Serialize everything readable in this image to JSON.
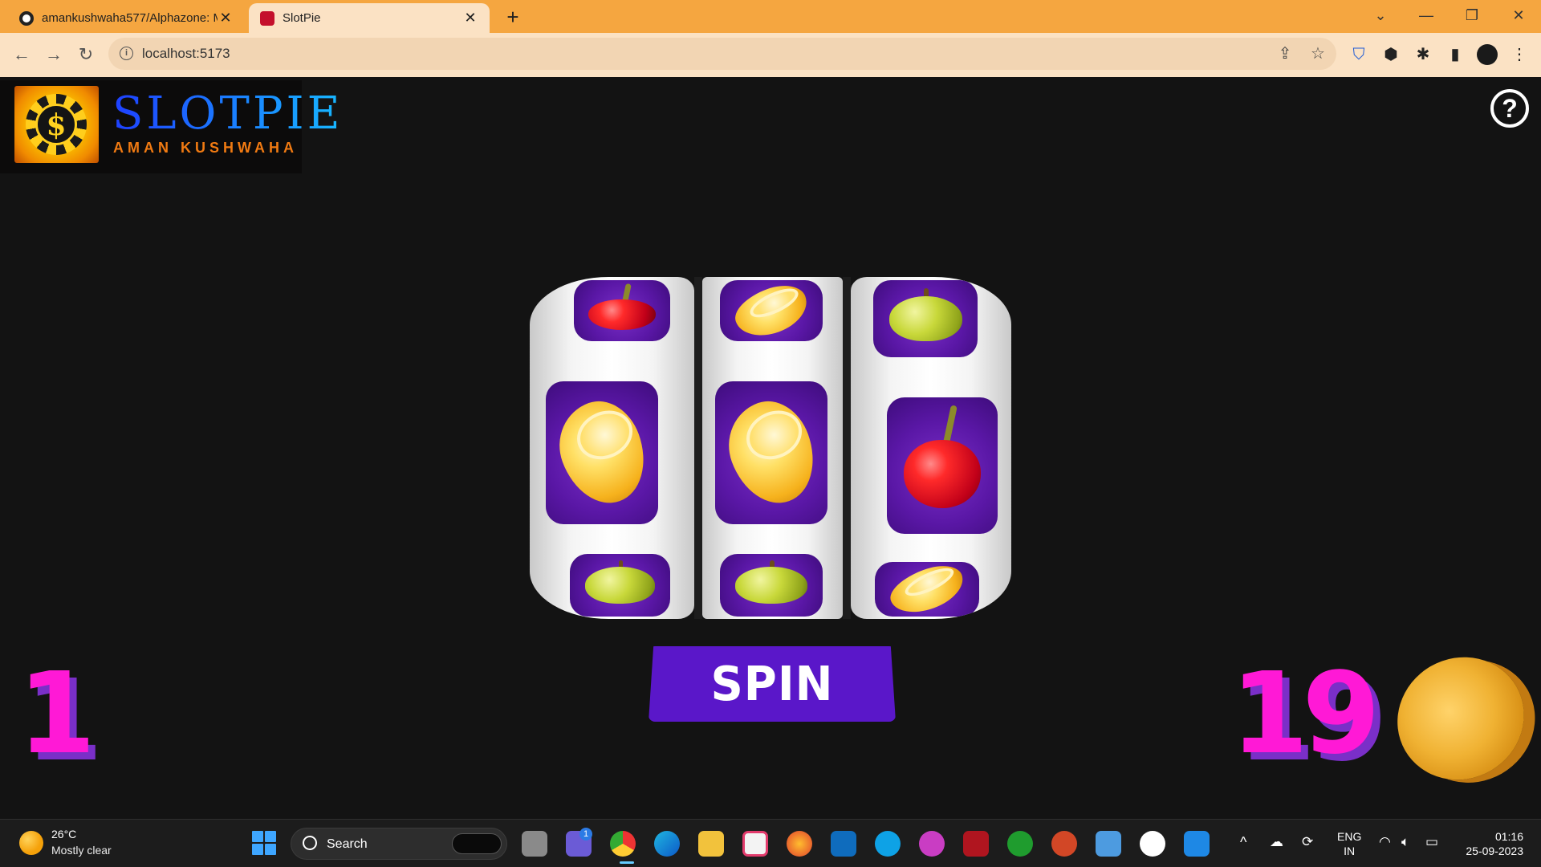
{
  "browser": {
    "tabs": [
      {
        "title": "amankushwaha577/Alphazone: M",
        "active": false
      },
      {
        "title": "SlotPie",
        "active": true
      }
    ],
    "new_tab_label": "+",
    "url": "localhost:5173"
  },
  "app": {
    "logo_title": "SLOTPIE",
    "logo_subtitle": "AMAN KUSHWAHA",
    "help_label": "?",
    "reels": [
      {
        "symbols": [
          "cherry",
          "lemon",
          "apple"
        ]
      },
      {
        "symbols": [
          "lemon",
          "lemon",
          "apple"
        ]
      },
      {
        "symbols": [
          "apple",
          "cherry",
          "lemon"
        ]
      }
    ],
    "spin_label": "SPIN",
    "left_counter": "1",
    "coins": "19",
    "colors": {
      "background": "#131313",
      "accent_pink": "#ff19d6",
      "accent_purple": "#5a17c9",
      "browser_orange": "#f5a640"
    }
  },
  "taskbar": {
    "weather_temp": "26°C",
    "weather_condition": "Mostly clear",
    "search_label": "Search",
    "language": "ENG",
    "region": "IN",
    "time": "01:16",
    "date": "25-09-2023",
    "teams_badge": "1"
  }
}
